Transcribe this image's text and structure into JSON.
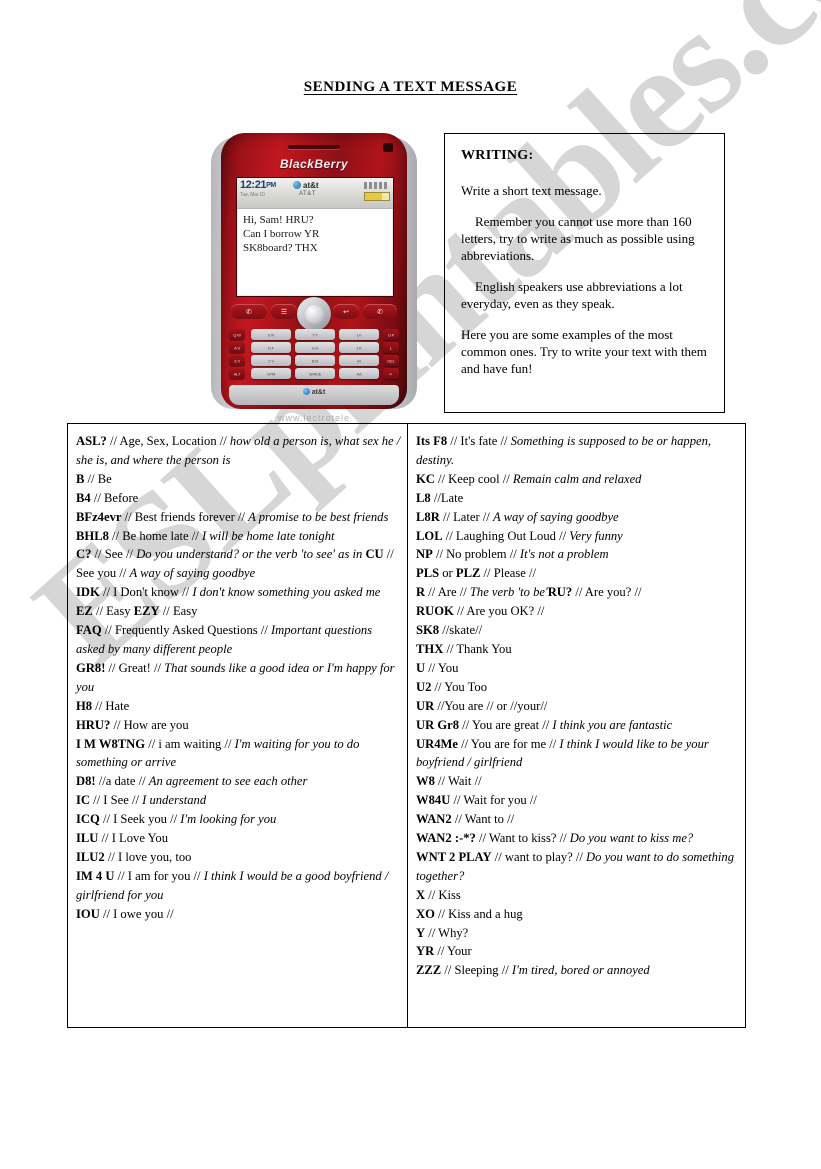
{
  "title": "SENDING A TEXT MESSAGE",
  "watermark": "ESLprintables.com",
  "phone": {
    "brand": "BlackBerry",
    "status_time": "12:21",
    "status_ampm": "PM",
    "status_date": "Tue, Mar 10",
    "carrier": "at&t",
    "carrier_secondary": "AT&T",
    "footer_carrier": "at&t",
    "photo_credit": "www.lectrotele",
    "message_lines": [
      "Hi, Sam! HRU?",
      "Can I borrow YR",
      "SK8board? THX"
    ],
    "keys": {
      "left_column": [
        "Q W",
        "A S",
        "Z X",
        "ALT"
      ],
      "right_column": [
        "O P",
        "L",
        "DEL",
        "↵"
      ],
      "main": [
        [
          "E R",
          "T Y",
          "U I"
        ],
        [
          "D F",
          "G H",
          "J K"
        ],
        [
          "C V",
          "B N",
          "M"
        ],
        [
          "SYM",
          "SPACE",
          "AA"
        ]
      ]
    },
    "mid_buttons": [
      "✆",
      "☰",
      "↩",
      "✆"
    ]
  },
  "writing": {
    "heading": "WRITING:",
    "paragraphs": [
      {
        "text": "Write a short text message.",
        "indent": false
      },
      {
        "text": "Remember you cannot use more than 160 letters, try to write as much as possible using abbreviations.",
        "indent": true
      },
      {
        "text": "English speakers use abbreviations a lot everyday, even as they speak.",
        "indent": true
      },
      {
        "text": "Here you are some examples of the most common ones. Try to write your text with them and have fun!",
        "indent": false
      }
    ]
  },
  "abbreviations": {
    "left": [
      {
        "abbr": "ASL?",
        "mean": " // Age, Sex, Location // ",
        "expl": "how old a person is, what sex he / she is, and where the person is"
      },
      {
        "abbr": "B",
        "mean": " // Be",
        "expl": ""
      },
      {
        "abbr": "B4",
        "mean": " // Before",
        "expl": ""
      },
      {
        "abbr": "BFz4evr",
        "mean": " // Best friends forever // ",
        "expl": "A promise to be best friends"
      },
      {
        "abbr": "BHL8",
        "mean": " // Be home late // ",
        "expl": "I will be home late tonight"
      },
      {
        "abbr": "C?",
        "mean": " // See // ",
        "expl": "Do you understand? or the verb 'to see' as in ",
        "abbr2": "CU",
        "mean2": " // See you // ",
        "expl2": "A way of saying goodbye"
      },
      {
        "abbr": "IDK",
        "mean": " // I Don't know // ",
        "expl": "I don't know something you asked me"
      },
      {
        "abbr": "EZ",
        "mean": " // Easy  ",
        "abbr2": "EZY",
        "mean2": " // Easy",
        "expl": ""
      },
      {
        "abbr": "FAQ",
        "mean": " // Frequently Asked Questions // ",
        "expl": "Important questions asked by many different people"
      },
      {
        "abbr": "GR8!",
        "mean": " // Great! // ",
        "expl": "That sounds like a good idea or I'm happy for you"
      },
      {
        "abbr": "H8",
        "mean": " // Hate",
        "expl": ""
      },
      {
        "abbr": "HRU?",
        "mean": " // How are you",
        "expl": ""
      },
      {
        "abbr": "I M W8TNG",
        "mean": " // i am waiting // ",
        "expl": "I'm waiting for you to do something or arrive"
      },
      {
        "abbr": "D8!",
        "mean": " //a date // ",
        "expl": "An agreement to see each other"
      },
      {
        "abbr": "IC",
        "mean": " // I See // ",
        "expl": "I understand"
      },
      {
        "abbr": "ICQ",
        "mean": " // I Seek you // ",
        "expl": "I'm looking for you"
      },
      {
        "abbr": "ILU",
        "mean": " // I Love You",
        "expl": ""
      },
      {
        "abbr": "ILU2",
        "mean": " // I love you, too",
        "expl": ""
      },
      {
        "abbr": "IM 4 U",
        "mean": " // I am for you // ",
        "expl": "I think I would be a good boyfriend / girlfriend for you"
      },
      {
        "abbr": "IOU",
        "mean": " // I owe you //",
        "expl": ""
      }
    ],
    "right": [
      {
        "abbr": "Its F8",
        "mean": " // It's fate // ",
        "expl": "Something is supposed to be or happen, destiny."
      },
      {
        "abbr": "KC",
        "mean": " // Keep cool // ",
        "expl": "Remain calm and relaxed"
      },
      {
        "abbr": "L8",
        "mean": " //Late",
        "expl": ""
      },
      {
        "abbr": "L8R",
        "mean": " // Later // ",
        "expl": "A way of saying goodbye"
      },
      {
        "abbr": "LOL",
        "mean": " // Laughing Out Loud // ",
        "expl": "Very funny"
      },
      {
        "abbr": "NP",
        "mean": " // No problem // ",
        "expl": "It's not a problem"
      },
      {
        "abbr": "PLS",
        "mean": " or ",
        "abbr2": "PLZ",
        "mean2": " // Please //",
        "expl": ""
      },
      {
        "abbr": "R",
        "mean": " // Are // ",
        "expl": "The verb 'to be'",
        "abbr2": "RU?",
        "mean2": " // Are you? //"
      },
      {
        "abbr": "RUOK",
        "mean": " // Are you OK? //",
        "expl": ""
      },
      {
        "abbr": "SK8",
        "mean": " //skate//",
        "expl": ""
      },
      {
        "abbr": "THX",
        "mean": " // Thank You",
        "expl": ""
      },
      {
        "abbr": "U",
        "mean": " // You",
        "expl": ""
      },
      {
        "abbr": "U2",
        "mean": " // You Too",
        "expl": ""
      },
      {
        "abbr": "UR",
        "mean": " //You are // or //your//",
        "expl": ""
      },
      {
        "abbr": "UR Gr8",
        "mean": " // You are great // ",
        "expl": "I think you are fantastic"
      },
      {
        "abbr": "UR4Me",
        "mean": " // You are for me // ",
        "expl": "I think I would like to be your boyfriend / girlfriend"
      },
      {
        "abbr": "W8",
        "mean": " // Wait //",
        "expl": ""
      },
      {
        "abbr": "W84U",
        "mean": " // Wait for you //",
        "expl": ""
      },
      {
        "abbr": "WAN2",
        "mean": " // Want to //",
        "expl": ""
      },
      {
        "abbr": "WAN2 :-*?",
        "mean": " // Want to kiss? // ",
        "expl": "Do you want to kiss me?"
      },
      {
        "abbr": "WNT 2 PLAY",
        "mean": " // want to play? // ",
        "expl": "Do you want to do something together?"
      },
      {
        "abbr": "X",
        "mean": " // Kiss",
        "expl": ""
      },
      {
        "abbr": "XO",
        "mean": " // Kiss and a hug",
        "expl": ""
      },
      {
        "abbr": "Y",
        "mean": " // Why?",
        "expl": ""
      },
      {
        "abbr": "YR",
        "mean": " // Your",
        "expl": ""
      },
      {
        "abbr": "ZZZ",
        "mean": " // Sleeping // ",
        "expl": "I'm tired, bored or annoyed"
      }
    ]
  }
}
